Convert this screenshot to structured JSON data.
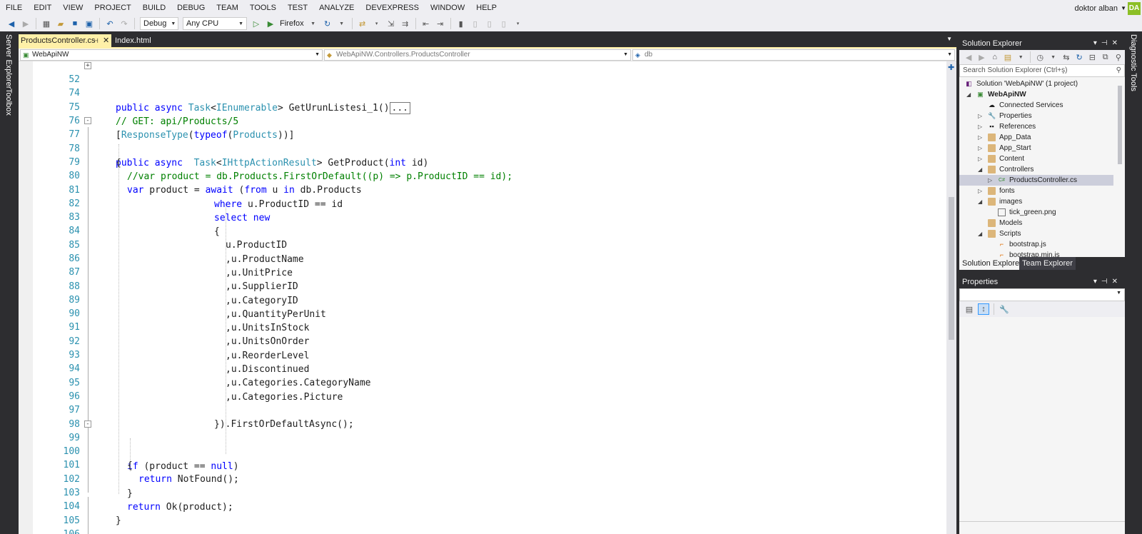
{
  "menu": {
    "items": [
      "FILE",
      "EDIT",
      "VIEW",
      "PROJECT",
      "BUILD",
      "DEBUG",
      "TEAM",
      "TOOLS",
      "TEST",
      "ANALYZE",
      "DEVEXPRESS",
      "WINDOW",
      "HELP"
    ],
    "user_name": "doktor alban",
    "user_initials": "DA"
  },
  "toolbar": {
    "config": "Debug",
    "platform": "Any CPU",
    "browser": "Firefox"
  },
  "left_strip": {
    "server_explorer": "Server Explorer",
    "toolbox": "Toolbox"
  },
  "right_strip": {
    "diagnostic_tools": "Diagnostic Tools"
  },
  "tabs": [
    {
      "label": "ProductsController.cs",
      "active": true
    },
    {
      "label": "Index.html",
      "active": false
    }
  ],
  "navbar": {
    "project": "WebApiNW",
    "type": "WebApiNW.Controllers.ProductsController",
    "member": "db"
  },
  "code": {
    "lines": [
      {
        "n": "52",
        "fold": "+"
      },
      {
        "n": "74"
      },
      {
        "n": "75"
      },
      {
        "n": "76"
      },
      {
        "n": "77",
        "fold": "-"
      },
      {
        "n": "78"
      },
      {
        "n": "79"
      },
      {
        "n": "80"
      },
      {
        "n": "81"
      },
      {
        "n": "82"
      },
      {
        "n": "83"
      },
      {
        "n": "84"
      },
      {
        "n": "85"
      },
      {
        "n": "86"
      },
      {
        "n": "87"
      },
      {
        "n": "88"
      },
      {
        "n": "89"
      },
      {
        "n": "90"
      },
      {
        "n": "91"
      },
      {
        "n": "92"
      },
      {
        "n": "93"
      },
      {
        "n": "94"
      },
      {
        "n": "95"
      },
      {
        "n": "96"
      },
      {
        "n": "97"
      },
      {
        "n": "98"
      },
      {
        "n": "99",
        "fold": "-"
      },
      {
        "n": "100"
      },
      {
        "n": "101"
      },
      {
        "n": "102"
      },
      {
        "n": "103"
      },
      {
        "n": "104"
      },
      {
        "n": "105"
      },
      {
        "n": "106"
      }
    ],
    "l52_a": "public async ",
    "l52_b": "Task",
    "l52_c": "<",
    "l52_d": "IEnumerable",
    "l52_e": "> GetUrunListesi_1()",
    "l52_collapsed": "...",
    "l75": "// GET: api/Products/5",
    "l76_a": "[",
    "l76_b": "ResponseType",
    "l76_c": "(",
    "l76_d": "typeof",
    "l76_e": "(",
    "l76_f": "Products",
    "l76_g": "))]",
    "l77_a": "public async  ",
    "l77_b": "Task",
    "l77_c": "<",
    "l77_d": "IHttpActionResult",
    "l77_e": "> GetProduct(",
    "l77_f": "int",
    "l77_g": " id)",
    "l78": "{",
    "l79": "//var product = db.Products.FirstOrDefault((p) => p.ProductID == id);",
    "l80_a": "var",
    "l80_b": " product = ",
    "l80_c": "await",
    "l80_d": " (",
    "l80_e": "from",
    "l80_f": " u ",
    "l80_g": "in",
    "l80_h": " db.Products",
    "l81_a": "where",
    "l81_b": " u.ProductID == id",
    "l82": "select new",
    "l83": "{",
    "l84": "u.ProductID",
    "l85": ",u.ProductName",
    "l86": ",u.UnitPrice",
    "l87": ",u.SupplierID",
    "l88": ",u.CategoryID",
    "l89": ",u.QuantityPerUnit",
    "l90": ",u.UnitsInStock",
    "l91": ",u.UnitsOnOrder",
    "l92": ",u.ReorderLevel",
    "l93": ",u.Discontinued",
    "l94": ",u.Categories.CategoryName",
    "l95": ",u.Categories.Picture",
    "l97": "}).FirstOrDefaultAsync();",
    "l99_a": "if",
    "l99_b": " (product == ",
    "l99_c": "null",
    "l99_d": ")",
    "l100": "{",
    "l101_a": "return",
    "l101_b": " NotFound();",
    "l102": "}",
    "l103_a": "return",
    "l103_b": " Ok(product);",
    "l104": "}"
  },
  "solution_explorer": {
    "title": "Solution Explorer",
    "search_placeholder": "Search Solution Explorer (Ctrl+ş)",
    "items": [
      {
        "label": "Solution 'WebApiNW' (1 project)",
        "level": 0
      },
      {
        "label": "WebApiNW",
        "level": 1
      },
      {
        "label": "Connected Services",
        "level": 2
      },
      {
        "label": "Properties",
        "level": 2
      },
      {
        "label": "References",
        "level": 2
      },
      {
        "label": "App_Data",
        "level": 2
      },
      {
        "label": "App_Start",
        "level": 2
      },
      {
        "label": "Content",
        "level": 2
      },
      {
        "label": "Controllers",
        "level": 2
      },
      {
        "label": "ProductsController.cs",
        "level": 3
      },
      {
        "label": "fonts",
        "level": 2
      },
      {
        "label": "images",
        "level": 2
      },
      {
        "label": "tick_green.png",
        "level": 3
      },
      {
        "label": "Models",
        "level": 2
      },
      {
        "label": "Scripts",
        "level": 2
      },
      {
        "label": "bootstrap.js",
        "level": 3
      },
      {
        "label": "bootstrap.min.js",
        "level": 3
      }
    ],
    "tabs": [
      "Solution Explorer",
      "Team Explorer"
    ]
  },
  "properties": {
    "title": "Properties"
  },
  "colors": {
    "keyword": "#0000ff",
    "type": "#2b91af",
    "comment": "#008000",
    "line_number": "#2b91af",
    "active_tab": "#fff0a8",
    "avatar": "#8cbf26"
  }
}
